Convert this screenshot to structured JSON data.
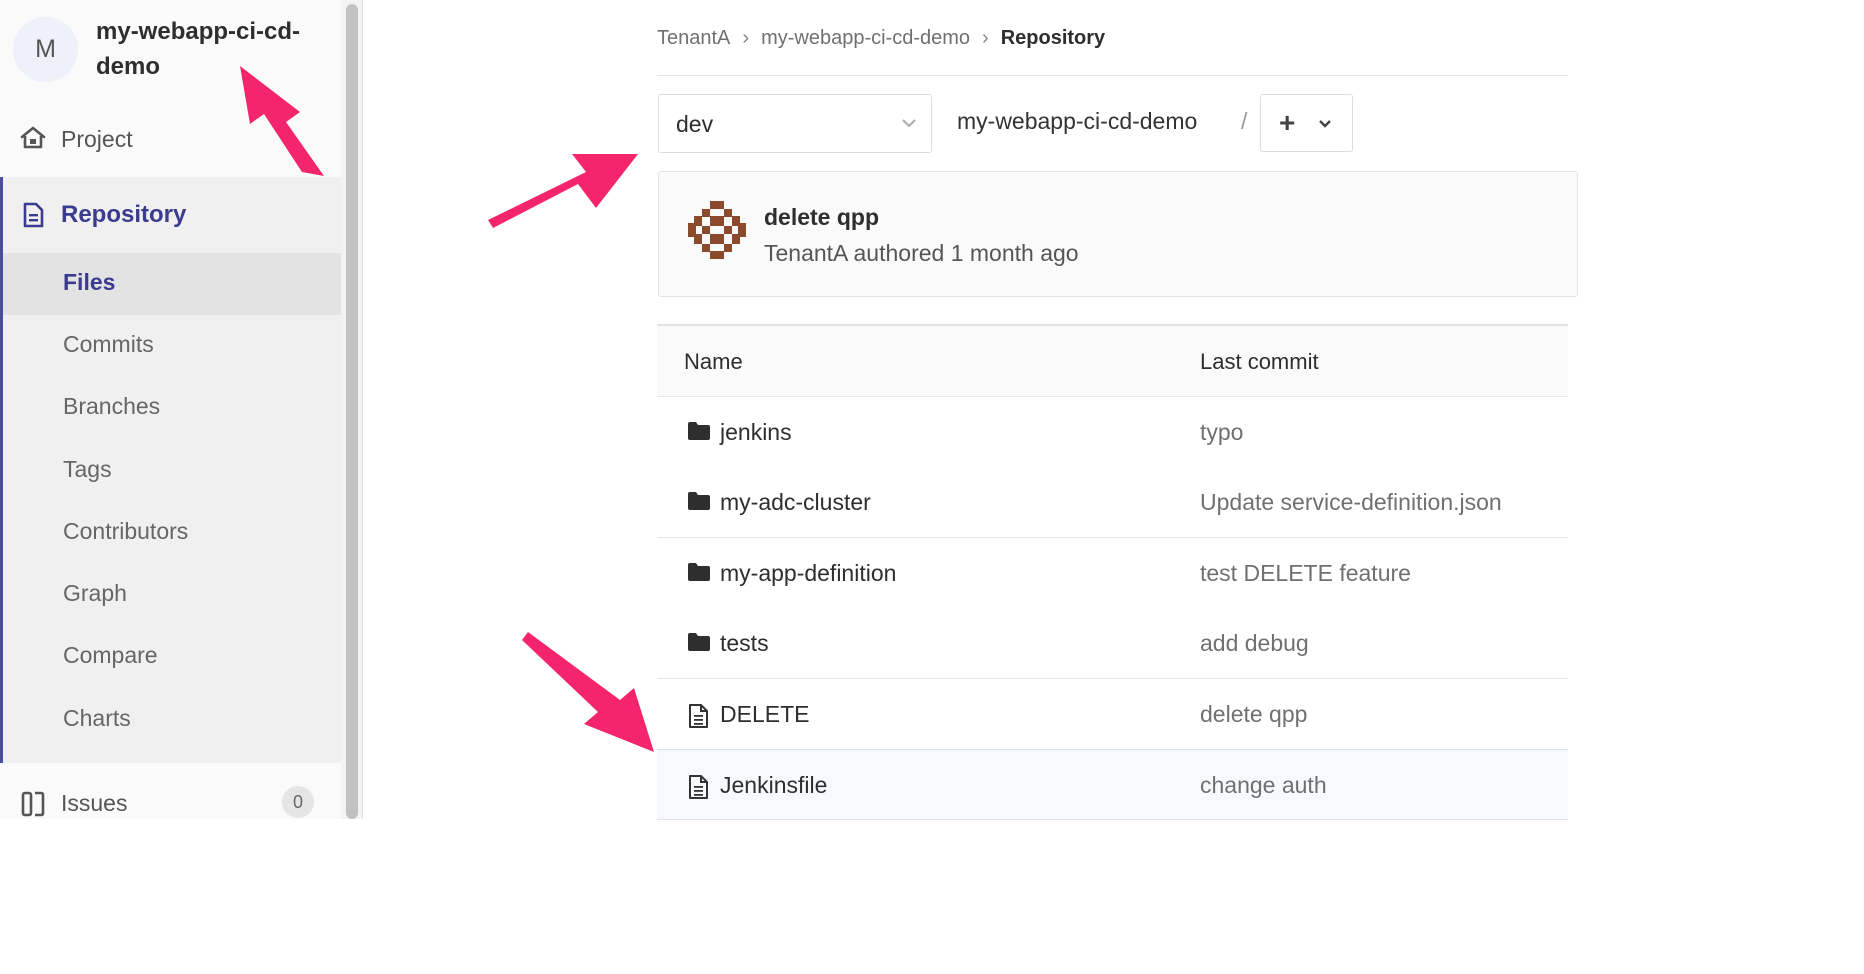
{
  "project": {
    "avatar_letter": "M",
    "name": "my-webapp-ci-cd-demo"
  },
  "sidebar": {
    "project_label": "Project",
    "repository_label": "Repository",
    "repo_items": [
      {
        "label": "Files",
        "active": true
      },
      {
        "label": "Commits"
      },
      {
        "label": "Branches"
      },
      {
        "label": "Tags"
      },
      {
        "label": "Contributors"
      },
      {
        "label": "Graph"
      },
      {
        "label": "Compare"
      },
      {
        "label": "Charts"
      }
    ],
    "issues_label": "Issues",
    "issues_count": "0"
  },
  "breadcrumb": {
    "items": [
      "TenantA",
      "my-webapp-ci-cd-demo",
      "Repository"
    ]
  },
  "toolbar": {
    "branch": "dev",
    "path": "my-webapp-ci-cd-demo",
    "separator": "/",
    "add_label": "+"
  },
  "last_commit": {
    "title": "delete qpp",
    "meta": "TenantA authored 1 month ago"
  },
  "table": {
    "headers": {
      "name": "Name",
      "last_commit": "Last commit"
    },
    "rows": [
      {
        "type": "folder",
        "name": "jenkins",
        "commit": "typo"
      },
      {
        "type": "folder",
        "name": "my-adc-cluster",
        "commit": "Update service-definition.json"
      },
      {
        "type": "folder",
        "name": "my-app-definition",
        "commit": "test DELETE feature"
      },
      {
        "type": "folder",
        "name": "tests",
        "commit": "add debug"
      },
      {
        "type": "file",
        "name": "DELETE",
        "commit": "delete qpp"
      },
      {
        "type": "file",
        "name": "Jenkinsfile",
        "commit": "change auth"
      }
    ]
  },
  "colors": {
    "accent": "#3b3b8f",
    "annotation_arrow": "#f5256d",
    "commit_avatar": "#8b4a2b"
  }
}
